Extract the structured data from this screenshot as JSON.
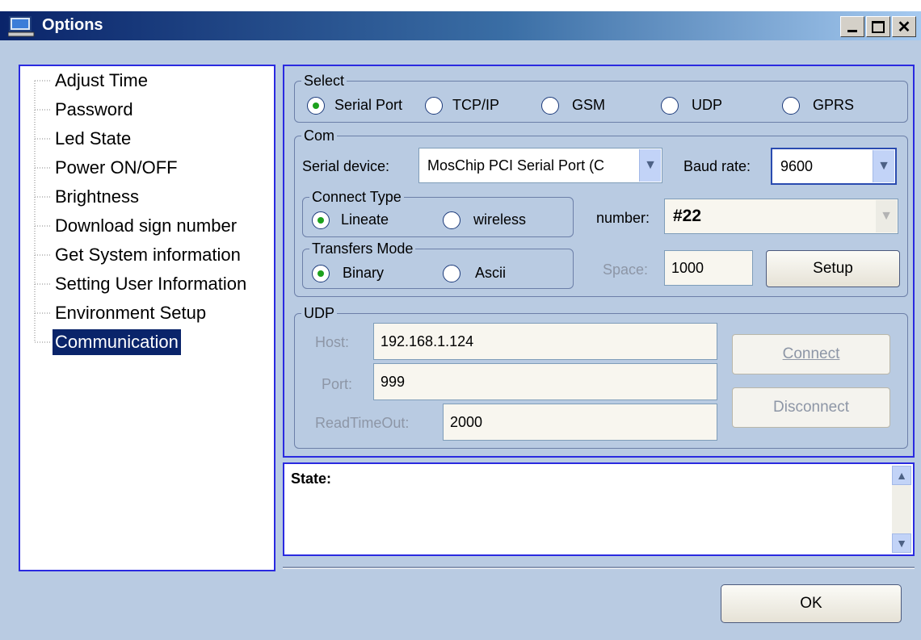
{
  "window": {
    "title": "Options"
  },
  "tree": {
    "items": [
      "Adjust Time",
      "Password",
      "Led State",
      "Power ON/OFF",
      "Brightness",
      "Download sign number",
      "Get System information",
      "Setting User Information",
      "Environment Setup",
      "Communication"
    ],
    "selected": "Communication"
  },
  "select_group": {
    "legend": "Select",
    "options": [
      {
        "label": "Serial Port",
        "selected": true
      },
      {
        "label": "TCP/IP",
        "selected": false
      },
      {
        "label": "GSM",
        "selected": false
      },
      {
        "label": "UDP",
        "selected": false
      },
      {
        "label": "GPRS",
        "selected": false
      }
    ]
  },
  "com_group": {
    "legend": "Com",
    "serial_device_label": "Serial device:",
    "serial_device_value": "MosChip PCI Serial Port (C",
    "baud_rate_label": "Baud rate:",
    "baud_rate_value": "9600",
    "connect_type": {
      "legend": "Connect Type",
      "options": [
        {
          "label": "Lineate",
          "selected": true
        },
        {
          "label": "wireless",
          "selected": false
        }
      ]
    },
    "number_label": "number:",
    "number_value": "#22",
    "transfers_mode": {
      "legend": "Transfers Mode",
      "options": [
        {
          "label": "Binary",
          "selected": true
        },
        {
          "label": "Ascii",
          "selected": false
        }
      ]
    },
    "space_label": "Space:",
    "space_value": "1000",
    "setup_button": "Setup"
  },
  "udp_group": {
    "legend": "UDP",
    "host_label": "Host:",
    "host_value": "192.168.1.124",
    "port_label": "Port:",
    "port_value": "999",
    "timeout_label": "ReadTimeOut:",
    "timeout_value": "2000",
    "connect_button": "Connect",
    "disconnect_button": "Disconnect"
  },
  "state": {
    "label": "State:"
  },
  "ok_button": "OK",
  "colors": {
    "title_start": "#0a246a",
    "selection": "#0a246a",
    "radio_dot": "#1da11d",
    "panel_border": "#2a2ae0",
    "client_bg": "#b9cbe2"
  }
}
